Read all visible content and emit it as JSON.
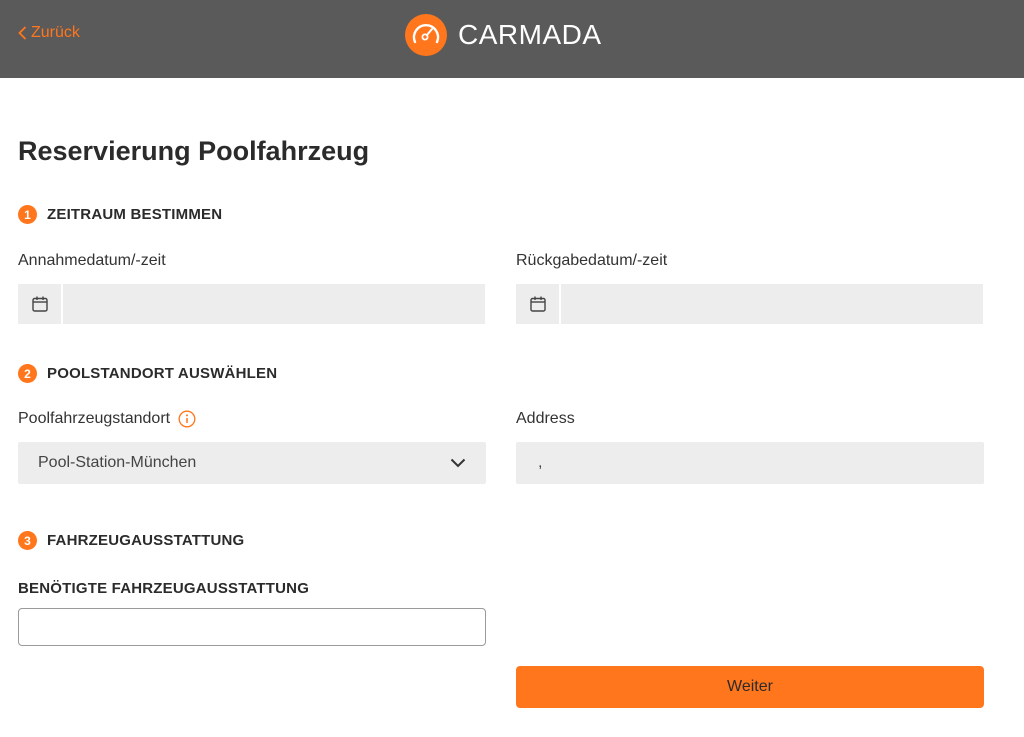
{
  "colors": {
    "accent": "#ff761c",
    "header_bg": "#5a5a5a",
    "field_bg": "#ededed"
  },
  "header": {
    "back_label": "Zurück",
    "brand_name": "CARMADA",
    "back_icon": "chevron-left-icon",
    "logo_icon": "speedometer-icon"
  },
  "page": {
    "title": "Reservierung Poolfahrzeug"
  },
  "sections": {
    "period": {
      "number": "1",
      "title": "ZEITRAUM BESTIMMEN",
      "pickup_label": "Annahmedatum/-zeit",
      "pickup_value": "",
      "return_label": "Rückgabedatum/-zeit",
      "return_value": "",
      "calendar_icon": "calendar-icon"
    },
    "location": {
      "number": "2",
      "title": "POOLSTANDORT AUSWÄHLEN",
      "station_label": "Poolfahrzeugstandort",
      "station_value": "Pool-Station-München",
      "address_label": "Address",
      "address_value": ",",
      "info_icon": "info-icon",
      "dropdown_icon": "chevron-down-icon"
    },
    "equipment": {
      "number": "3",
      "title": "FAHRZEUGAUSSTATTUNG",
      "required_label": "BENÖTIGTE FAHRZEUGAUSSTATTUNG",
      "required_value": ""
    }
  },
  "actions": {
    "next_label": "Weiter"
  }
}
